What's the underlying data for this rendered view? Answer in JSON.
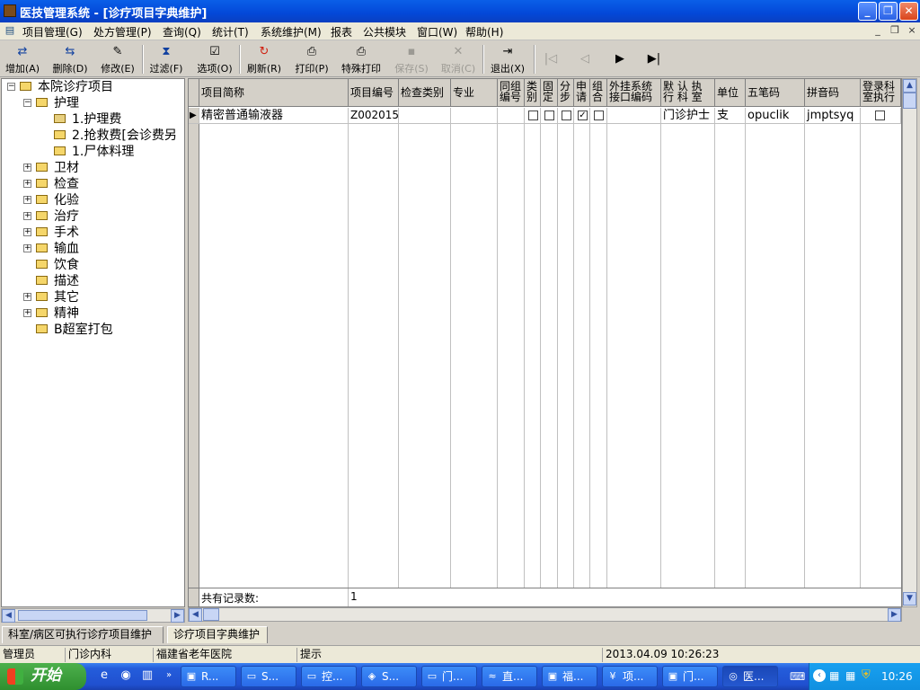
{
  "window": {
    "title": "医技管理系统 - [诊疗项目字典维护]",
    "controls": {
      "minimize": "_",
      "restore": "❐",
      "close": "✕"
    }
  },
  "menu": {
    "items": [
      "项目管理(G)",
      "处方管理(P)",
      "查询(Q)",
      "统计(T)",
      "系统维护(M)",
      "报表",
      "公共模块",
      "窗口(W)",
      "帮助(H)"
    ],
    "mdi": {
      "minimize": "_",
      "restore": "❐",
      "close": "×"
    }
  },
  "toolbar": {
    "add": "增加(A)",
    "delete": "删除(D)",
    "modify": "修改(E)",
    "filter": "过滤(F)",
    "options": "选项(O)",
    "refresh": "刷新(R)",
    "print": "打印(P)",
    "special_print": "特殊打印",
    "save": "保存(S)",
    "cancel": "取消(C)",
    "exit": "退出(X)"
  },
  "tree": {
    "root": "本院诊疗项目",
    "nodes": [
      "护理",
      "1.护理费",
      "2.抢救费[会诊费另",
      "1.尸体料理",
      "卫材",
      "检查",
      "化验",
      "治疗",
      "手术",
      "输血",
      "饮食",
      "描述",
      "其它",
      "精神",
      "B超室打包"
    ]
  },
  "grid": {
    "headers": [
      "项目简称",
      "项目编号",
      "检查类别",
      "专业",
      "同组\n编号",
      "类\n别",
      "固\n定",
      "分\n步",
      "申\n请",
      "组\n合",
      "外挂系统\n接口编码",
      "默 认 执\n行 科 室",
      "单位",
      "五笔码",
      "拼音码",
      "登录科\n室执行"
    ],
    "row": {
      "name": "精密普通输液器",
      "code": "Z002015",
      "exam_type": "",
      "specialty": "",
      "group_no": "",
      "dept": "门诊护士",
      "unit": "支",
      "wubi": "opuclik",
      "pinyin": "jmptsyq",
      "checked_apply": "✓"
    },
    "footer_label": "共有记录数:",
    "footer_count": "1"
  },
  "tabs": [
    "科室/病区可执行诊疗项目维护",
    "诊疗项目字典维护"
  ],
  "status": {
    "user": "管理员",
    "dept": "门诊内科",
    "hospital": "福建省老年医院",
    "hint": "提示",
    "datetime": "2013.04.09 10:26:23"
  },
  "taskbar": {
    "start": "开始",
    "tasks": [
      "R...",
      "S...",
      "控...",
      "S...",
      "门...",
      "直...",
      "福...",
      "项...",
      "门...",
      "医..."
    ],
    "clock": "10:26"
  }
}
